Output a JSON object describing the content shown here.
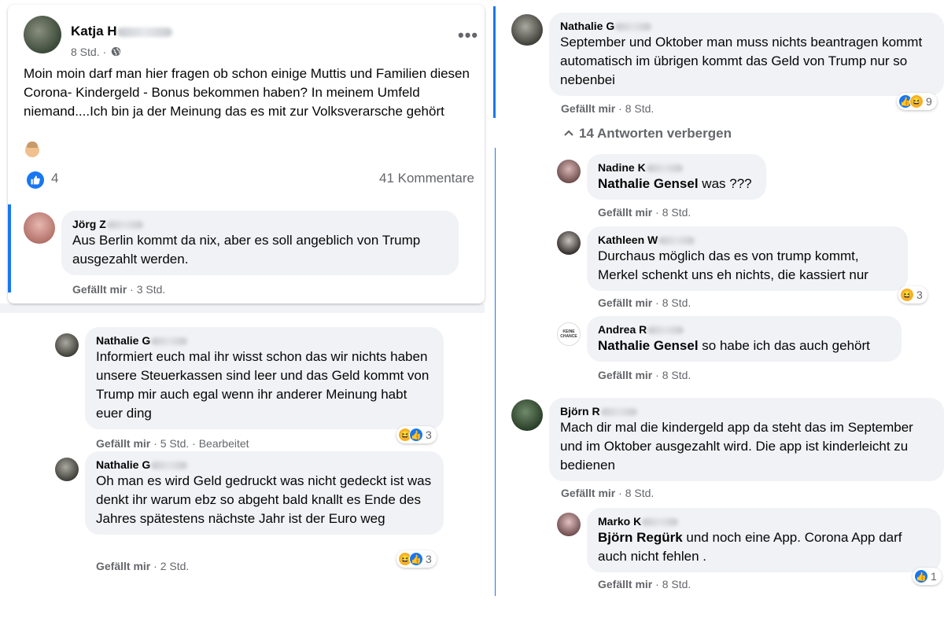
{
  "post": {
    "author_visible": "Katja H",
    "time": "8 Std. ·",
    "more": "•••",
    "text": "Moin moin darf man hier fragen ob schon einige Muttis und Familien diesen Corona- Kindergeld - Bonus bekommen haben? In meinem Umfeld niemand....Ich bin ja der Meinung das es mit zur Volksverarsche gehört",
    "like_count": "4",
    "comments_count": "41 Kommentare"
  },
  "left_comments": [
    {
      "name": "Jörg Z",
      "text": "Aus Berlin kommt da nix, aber es soll angeblich von Trump ausgezahlt werden.",
      "like_label": "Gefällt mir",
      "time": " · 3 Std."
    },
    {
      "name": "Nathalie G",
      "text": "Informiert euch mal ihr wisst schon das wir nichts haben unsere Steuerkassen sind leer und das Geld kommt von Trump mir auch egal wenn ihr anderer Meinung habt euer ding",
      "like_label": "Gefällt mir",
      "time": " · 5 Std. · Bearbeitet",
      "reactions": "3"
    },
    {
      "name": "Nathalie G",
      "text": "Oh man es wird Geld gedruckt was nicht gedeckt ist was denkt ihr warum ebz so abgeht bald knallt es Ende des Jahres spätestens nächste Jahr ist der Euro weg",
      "like_label": "Gefällt mir",
      "time": " · 2 Std.",
      "reactions": "3"
    }
  ],
  "right_comments": {
    "main": {
      "name": "Nathalie G",
      "text": "September und Oktober man muss nichts beantragen kommt automatisch im übrigen kommt das Geld von Trump nur so nebenbei",
      "like_label": "Gefällt mir",
      "time": " · 8 Std.",
      "reactions": "9"
    },
    "toggle": "14 Antworten verbergen",
    "replies": [
      {
        "name": "Nadine K",
        "mention": "Nathalie Gensel",
        "text": " was ???",
        "like_label": "Gefällt mir",
        "time": " · 8 Std."
      },
      {
        "name": "Kathleen W",
        "text": "Durchaus möglich das es von trump kommt, Merkel schenkt uns eh nichts, die kassiert nur",
        "like_label": "Gefällt mir",
        "time": " · 8 Std.",
        "reactions": "3"
      },
      {
        "name": "Andrea R",
        "mention": "Nathalie Gensel",
        "text": " so habe ich das auch gehört",
        "like_label": "Gefällt mir",
        "time": " · 8 Std.",
        "avatar_text": "KEINE CHANCE"
      },
      {
        "name": "Björn R",
        "text": "Mach dir mal die kindergeld app da steht das im September und im Oktober ausgezahlt wird. Die app ist kinderleicht zu bedienen",
        "like_label": "Gefällt mir",
        "time": " · 8 Std."
      },
      {
        "name": "Marko K",
        "mention": "Björn Regürk",
        "text": " und noch eine App. Corona App darf auch nicht fehlen .",
        "like_label": "Gefällt mir",
        "time": " · 8 Std.",
        "reactions": "1"
      }
    ]
  },
  "colors": {
    "accent": "#1877f2",
    "bubble": "#f0f2f5",
    "meta": "#65676b",
    "haha": "#f7b125"
  },
  "icons": [
    "globe-icon",
    "like-icon",
    "haha-icon",
    "chevron-up-icon",
    "more-icon"
  ]
}
